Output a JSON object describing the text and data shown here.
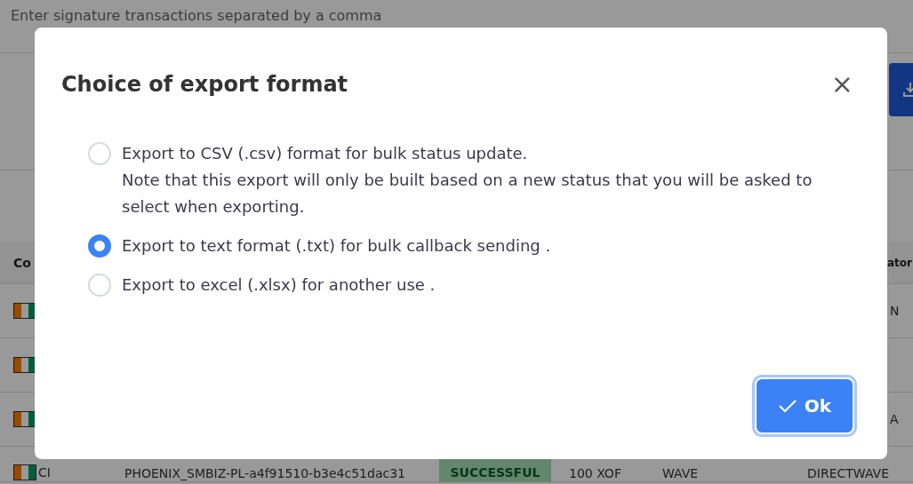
{
  "page": {
    "search": {
      "placeholder": "Enter signature transactions separated by a comma"
    },
    "table": {
      "columns": [
        {
          "text": "Co"
        },
        {
          "text": "ator"
        }
      ],
      "rows": [
        {
          "operator_cut": "N"
        },
        {},
        {
          "operator_cut": "A"
        },
        {
          "country": "CI",
          "reference": "PHOENIX_SMBIZ-PL-a4f91510-b3e4c51dac31",
          "status": "SUCCESSFUL",
          "amount": "100 XOF",
          "method": "WAVE",
          "operator": "DIRECTWAVE"
        }
      ]
    }
  },
  "dialog": {
    "title": "Choice of export format",
    "close": "×",
    "options": [
      {
        "label": "Export to CSV (.csv) format for bulk status update.",
        "note": "Note that this export will only be built based on a new status that you will be asked to select when exporting.",
        "selected": false
      },
      {
        "label": "Export to text format (.txt) for bulk callback sending .",
        "selected": true
      },
      {
        "label": "Export to excel (.xlsx) for another use .",
        "selected": false
      }
    ],
    "ok_button": {
      "label": "Ok"
    }
  }
}
